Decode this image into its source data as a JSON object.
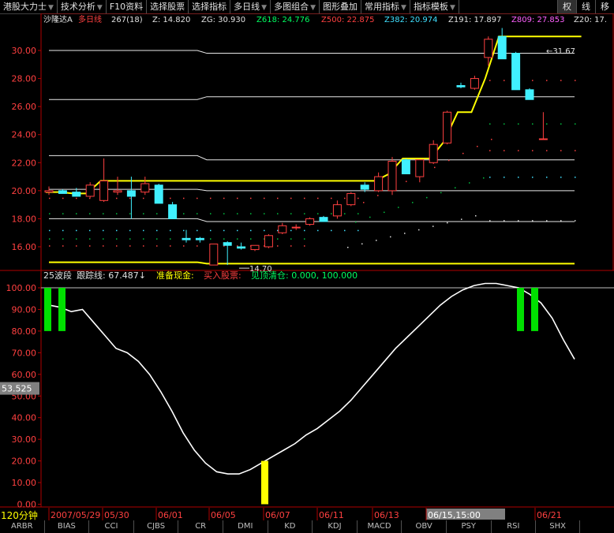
{
  "toolbar": {
    "items": [
      {
        "label": "港股大力士",
        "arrow": "▼"
      },
      {
        "label": "技术分析",
        "arrow": "▼"
      },
      {
        "label": "F10资料",
        "arrow": ""
      },
      {
        "label": "选择股票",
        "arrow": ""
      },
      {
        "label": "选择指标",
        "arrow": ""
      },
      {
        "label": "多日线",
        "arrow": "▼"
      },
      {
        "label": "多图组合",
        "arrow": "▼"
      },
      {
        "label": "图形叠加",
        "arrow": ""
      },
      {
        "label": "常用指标",
        "arrow": "▼"
      },
      {
        "label": "指标模板",
        "arrow": "▼"
      }
    ],
    "right": [
      "权",
      "线",
      "移"
    ]
  },
  "main_header": {
    "stock": "沙隆达A",
    "period": "多日线",
    "count": "267(18)",
    "items": [
      {
        "text": "Z: 14.820",
        "color": "#e0e0e0"
      },
      {
        "text": "ZG: 30.930",
        "color": "#e0e0e0"
      },
      {
        "text": "Z618: 24.776",
        "color": "#00ff60"
      },
      {
        "text": "Z500: 22.875",
        "color": "#ff4040"
      },
      {
        "text": "Z382: 20.974",
        "color": "#40e0ff"
      },
      {
        "text": "Z191: 17.897",
        "color": "#e0e0e0"
      },
      {
        "text": "Z809: 27.853",
        "color": "#ff60ff"
      },
      {
        "text": "Z20: 17.",
        "color": "#e0e0e0"
      }
    ]
  },
  "sub_header": {
    "items": [
      {
        "text": "25波段",
        "color": "#e0e0e0"
      },
      {
        "text": "跟踪线: 67.487↓",
        "color": "#e0e0e0"
      },
      {
        "text": "准备现金:",
        "color": "#ffff00"
      },
      {
        "text": "买入股票:",
        "color": "#ff4040"
      },
      {
        "text": "见顶清仓: 0.000, 100.000",
        "color": "#00ff60"
      }
    ]
  },
  "price_axis": [
    "30.00",
    "28.00",
    "26.00",
    "24.00",
    "22.00",
    "20.00",
    "18.00",
    "16.00"
  ],
  "osc_axis": [
    "100.00",
    "90.00",
    "80.00",
    "70.00",
    "60.00",
    "50.00",
    "40.00",
    "30.00",
    "20.00",
    "10.00",
    "0.00"
  ],
  "cursor_value": "53.525",
  "annotations": {
    "high": "31.67",
    "low": "14.70"
  },
  "period_label": "120分钟",
  "date_labels": [
    "2007/05/29",
    "05/30",
    "06/01",
    "06/05",
    "06/07",
    "06/11",
    "06/13",
    "06/15,15:00",
    "06/21"
  ],
  "indicator_tabs": [
    "ARBR",
    "BIAS",
    "CCI",
    "CJBS",
    "CR",
    "DMI",
    "KD",
    "KDJ",
    "MACD",
    "OBV",
    "PSY",
    "RSI",
    "SHX"
  ],
  "chart_data": {
    "type": "candlestick",
    "price_ylim": [
      14.5,
      31.5
    ],
    "osc_ylim": [
      0,
      100
    ],
    "candles": [
      {
        "o": 19.9,
        "h": 20.3,
        "l": 19.7,
        "c": 20.0
      },
      {
        "o": 20.0,
        "h": 20.1,
        "l": 19.8,
        "c": 19.8
      },
      {
        "o": 19.9,
        "h": 20.2,
        "l": 19.6,
        "c": 19.6
      },
      {
        "o": 19.6,
        "h": 20.6,
        "l": 19.5,
        "c": 20.4
      },
      {
        "o": 19.3,
        "h": 22.3,
        "l": 19.2,
        "c": 20.7
      },
      {
        "o": 19.9,
        "h": 21.0,
        "l": 19.7,
        "c": 20.0
      },
      {
        "o": 20.0,
        "h": 21.0,
        "l": 18.0,
        "c": 19.6
      },
      {
        "o": 19.9,
        "h": 21.0,
        "l": 19.7,
        "c": 20.5
      },
      {
        "o": 20.4,
        "h": 20.5,
        "l": 19.1,
        "c": 19.1
      },
      {
        "o": 19.0,
        "h": 19.2,
        "l": 18.0,
        "c": 18.0
      },
      {
        "o": 16.6,
        "h": 17.2,
        "l": 16.3,
        "c": 16.5
      },
      {
        "o": 16.6,
        "h": 16.7,
        "l": 16.3,
        "c": 16.5
      },
      {
        "o": 14.7,
        "h": 16.2,
        "l": 14.7,
        "c": 16.2
      },
      {
        "o": 16.3,
        "h": 16.4,
        "l": 14.7,
        "c": 16.1
      },
      {
        "o": 16.0,
        "h": 16.3,
        "l": 15.8,
        "c": 15.9
      },
      {
        "o": 15.8,
        "h": 16.1,
        "l": 15.7,
        "c": 16.1
      },
      {
        "o": 16.0,
        "h": 16.9,
        "l": 15.9,
        "c": 16.8
      },
      {
        "o": 17.0,
        "h": 17.7,
        "l": 16.9,
        "c": 17.5
      },
      {
        "o": 17.4,
        "h": 17.6,
        "l": 17.2,
        "c": 17.4
      },
      {
        "o": 17.6,
        "h": 18.1,
        "l": 17.5,
        "c": 18.0
      },
      {
        "o": 18.1,
        "h": 18.2,
        "l": 17.8,
        "c": 17.8
      },
      {
        "o": 18.2,
        "h": 19.3,
        "l": 18.0,
        "c": 19.0
      },
      {
        "o": 19.0,
        "h": 19.9,
        "l": 18.9,
        "c": 19.8
      },
      {
        "o": 20.4,
        "h": 20.6,
        "l": 19.9,
        "c": 20.1
      },
      {
        "o": 20.0,
        "h": 21.3,
        "l": 19.9,
        "c": 21.0
      },
      {
        "o": 20.0,
        "h": 22.4,
        "l": 19.7,
        "c": 22.1
      },
      {
        "o": 22.2,
        "h": 22.3,
        "l": 21.2,
        "c": 21.2
      },
      {
        "o": 21.0,
        "h": 22.2,
        "l": 20.6,
        "c": 22.2
      },
      {
        "o": 22.0,
        "h": 23.6,
        "l": 21.9,
        "c": 23.3
      },
      {
        "o": 23.4,
        "h": 25.7,
        "l": 23.3,
        "c": 25.6
      },
      {
        "o": 27.5,
        "h": 27.7,
        "l": 27.3,
        "c": 27.4
      },
      {
        "o": 27.3,
        "h": 28.2,
        "l": 27.2,
        "c": 28.0
      },
      {
        "o": 29.5,
        "h": 31.0,
        "l": 28.9,
        "c": 30.8
      },
      {
        "o": 31.0,
        "h": 31.6,
        "l": 29.4,
        "c": 29.4
      },
      {
        "o": 29.8,
        "h": 29.9,
        "l": 27.2,
        "c": 27.2
      },
      {
        "o": 27.2,
        "h": 27.3,
        "l": 26.5,
        "c": 26.5
      },
      {
        "o": 23.7,
        "h": 25.6,
        "l": 23.7,
        "c": 23.7
      }
    ],
    "yellow_line": [
      19.9,
      19.9,
      19.8,
      19.8,
      20.7,
      20.7,
      20.7,
      20.7,
      20.7,
      20.7,
      20.7,
      20.7,
      20.7,
      20.7,
      20.7,
      20.7,
      20.7,
      20.7,
      20.7,
      20.7,
      20.7,
      20.7,
      20.7,
      20.7,
      20.7,
      21.2,
      22.3,
      22.3,
      22.3,
      23.5,
      25.6,
      25.6,
      28.0,
      31.0,
      31.0,
      31.0,
      31.0,
      31.0,
      31.0,
      31.0
    ],
    "white_levels": [
      {
        "y": 30.0,
        "y2": 29.8
      },
      {
        "y": 26.5,
        "y2": 26.7
      },
      {
        "y": 22.5,
        "y2": 22.2
      },
      {
        "y": 20.1,
        "y2": 20.0
      },
      {
        "y": 18.0,
        "y2": 17.8
      }
    ],
    "yellow_bottom": {
      "y": 14.9,
      "y2": 14.8
    },
    "oscillator": [
      92,
      91,
      89,
      90,
      84,
      78,
      72,
      70,
      66,
      60,
      52,
      43,
      33,
      25,
      19,
      15,
      14,
      14,
      16,
      19,
      22,
      25,
      28,
      32,
      35,
      39,
      43,
      48,
      54,
      60,
      66,
      72,
      77,
      82,
      87,
      92,
      96,
      99,
      101,
      102,
      102,
      101,
      100,
      97,
      93,
      86,
      76,
      67
    ],
    "green_bars": [
      {
        "x": 0,
        "from": 80,
        "to": 100
      },
      {
        "x": 1,
        "from": 80,
        "to": 100
      },
      {
        "x": 37,
        "from": 80,
        "to": 100
      },
      {
        "x": 38,
        "from": 80,
        "to": 100
      }
    ],
    "yellow_bars": [
      {
        "x": 16,
        "from": 0,
        "to": 20
      }
    ]
  }
}
